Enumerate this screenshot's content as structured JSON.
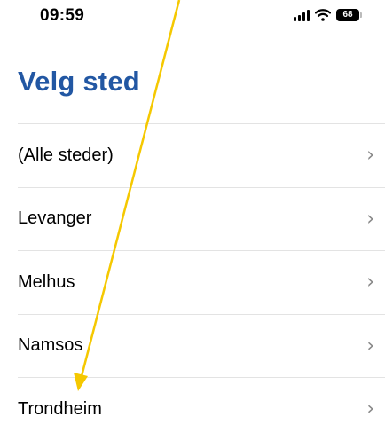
{
  "status_bar": {
    "time": "09:59",
    "battery_level": "68"
  },
  "page": {
    "title": "Velg sted"
  },
  "places": [
    {
      "label": "(Alle steder)"
    },
    {
      "label": "Levanger"
    },
    {
      "label": "Melhus"
    },
    {
      "label": "Namsos"
    },
    {
      "label": "Trondheim"
    }
  ],
  "icons": {
    "row_chevron": "chevron-right-icon",
    "signal": "cellular-signal-icon",
    "wifi": "wifi-icon",
    "battery": "battery-icon"
  },
  "colors": {
    "title": "#2257a3",
    "annotation_arrow": "#f5c800"
  }
}
